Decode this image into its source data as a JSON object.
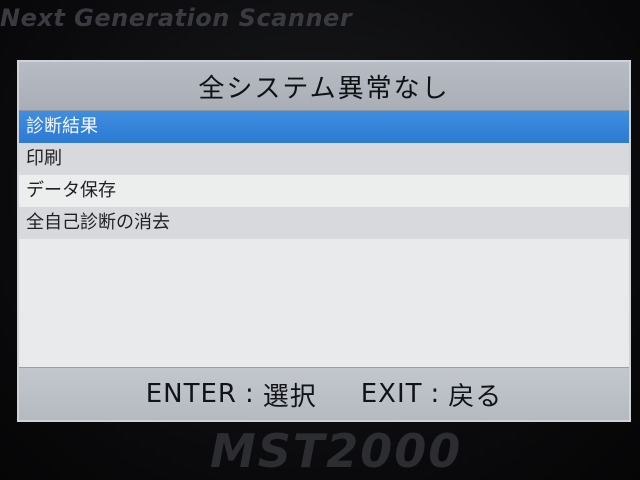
{
  "device": {
    "brand_text": "Next Generation Scanner",
    "model_text": "MST2000"
  },
  "screen": {
    "title": "全システム異常なし",
    "menu": [
      {
        "label": "診断結果",
        "selected": true
      },
      {
        "label": "印刷",
        "selected": false
      },
      {
        "label": "データ保存",
        "selected": false
      },
      {
        "label": "全自己診断の消去",
        "selected": false
      }
    ],
    "footer": {
      "enter_key": "ENTER",
      "enter_action": "選択",
      "exit_key": "EXIT",
      "exit_action": "戻る",
      "separator": ":"
    }
  },
  "colors": {
    "selection": "#2c7ad2",
    "title_bar": "#b7bcc4",
    "footer_bar": "#c3c7cd"
  }
}
